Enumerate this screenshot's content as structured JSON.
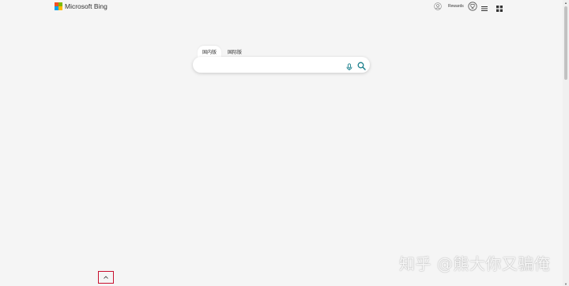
{
  "header": {
    "logo_text": "Microsoft Bing",
    "rewards_label": "Rewards",
    "logo_colors": [
      "#f25022",
      "#7fba00",
      "#00a4ef",
      "#ffb900"
    ]
  },
  "search": {
    "tabs": [
      {
        "label": "国内版",
        "active": true
      },
      {
        "label": "国际版",
        "active": false
      }
    ],
    "query": "",
    "placeholder": "",
    "accent_color": "#1a7f8c"
  },
  "watermark": "知乎 @熊大你又骗俺",
  "scrollbar": {
    "up_arrow": "▲",
    "down_arrow": "▼"
  }
}
